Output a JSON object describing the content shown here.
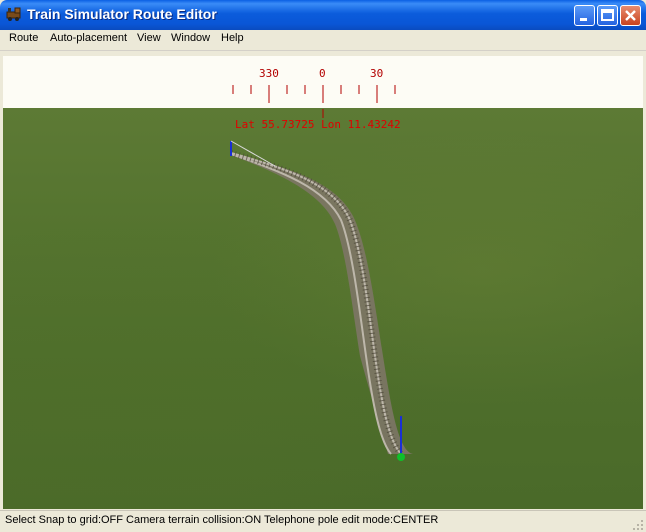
{
  "window": {
    "title": "Train Simulator Route Editor"
  },
  "menu": {
    "items": [
      "Route",
      "Auto-placement",
      "View",
      "Window",
      "Help"
    ]
  },
  "compass": {
    "labels": [
      "330",
      "0",
      "30"
    ],
    "heading": 0
  },
  "viewport": {
    "coordinates": "Lat 55.73725 Lon 11.43242"
  },
  "status": {
    "text": "Select   Snap to grid:OFF Camera terrain collision:ON Telephone pole edit mode:CENTER"
  },
  "colors": {
    "titlebar": "#0a5fe3",
    "compass": "#b30000",
    "ground": "#55742f",
    "sky": "#fdfcf5"
  }
}
